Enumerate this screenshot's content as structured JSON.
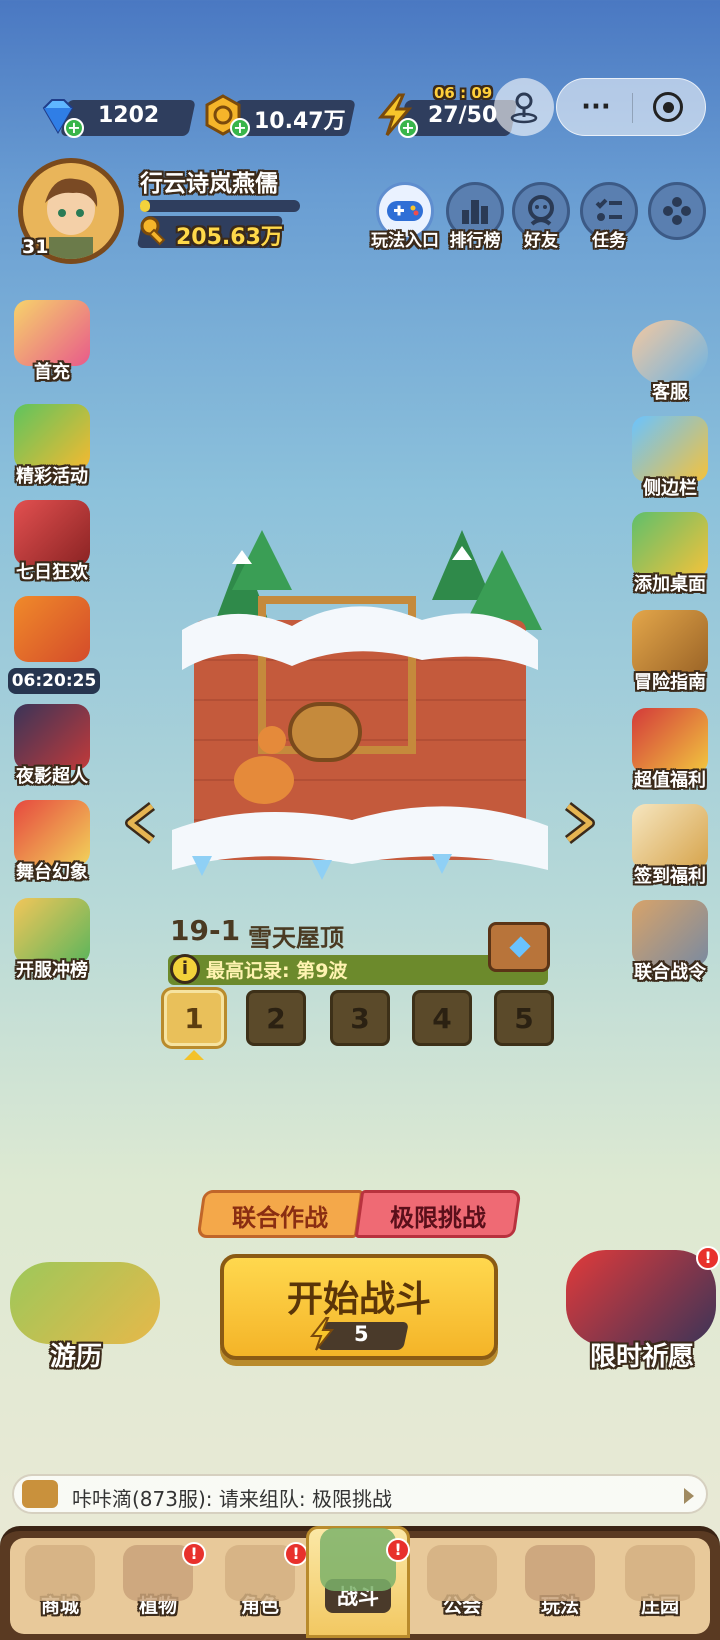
{
  "resources": {
    "diamonds": "1202",
    "gold": "10.47万",
    "energy": "27/50",
    "energy_timer": "06 : 09"
  },
  "player": {
    "name": "行云诗岚燕儒",
    "level": "31",
    "power": "205.63万",
    "exp_progress": 0.06
  },
  "top_menu": [
    {
      "label": "玩法入口",
      "icon": "gamepad-icon"
    },
    {
      "label": "排行榜",
      "icon": "leaderboard-icon"
    },
    {
      "label": "好友",
      "icon": "friends-icon"
    },
    {
      "label": "任务",
      "icon": "tasks-icon"
    },
    {
      "label": "",
      "icon": "more-icon"
    }
  ],
  "left_menu": [
    {
      "label": "首充"
    },
    {
      "label": "精彩活动"
    },
    {
      "label": "七日狂欢"
    },
    {
      "label": "06:20:25"
    },
    {
      "label": "夜影超人"
    },
    {
      "label": "舞台幻象"
    },
    {
      "label": "开服冲榜"
    }
  ],
  "right_menu": [
    {
      "label": "客服"
    },
    {
      "label": "侧边栏"
    },
    {
      "label": "添加桌面"
    },
    {
      "label": "冒险指南"
    },
    {
      "label": "超值福利"
    },
    {
      "label": "签到福利"
    },
    {
      "label": "联合战令"
    }
  ],
  "stage": {
    "title": "19-1",
    "name": "雪天屋顶",
    "record": "最高记录: 第9波",
    "sub_stages": [
      "1",
      "2",
      "3",
      "4",
      "5"
    ],
    "selected": 0
  },
  "modes": {
    "coop": "联合作战",
    "extreme": "极限挑战"
  },
  "start": {
    "label": "开始战斗",
    "cost": "5"
  },
  "travel_label": "游历",
  "wish_label": "限时祈愿",
  "chat": "咔咔滴(873服): 请来组队: 极限挑战",
  "nav": [
    {
      "label": "商城",
      "badge": false
    },
    {
      "label": "植物",
      "badge": true
    },
    {
      "label": "角色",
      "badge": true
    },
    {
      "label": "战斗",
      "badge": true
    },
    {
      "label": "公会",
      "badge": false
    },
    {
      "label": "玩法",
      "badge": false
    },
    {
      "label": "庄园",
      "badge": false
    }
  ]
}
